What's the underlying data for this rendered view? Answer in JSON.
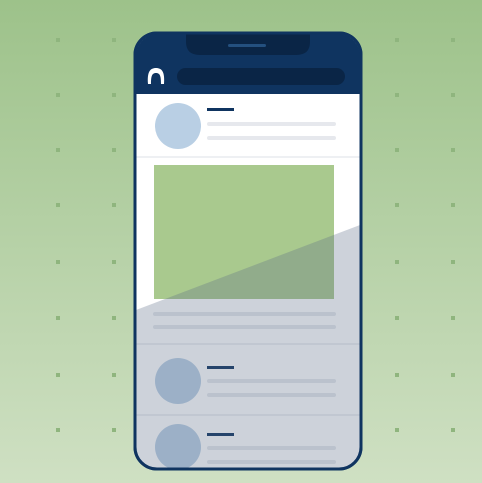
{
  "illustration": {
    "subject": "smartphone-social-feed",
    "colors": {
      "background_top": "#9dc28a",
      "background_bottom": "#cfe0c3",
      "dot": "#8fb57e",
      "phone_frame": "#0f3460",
      "phone_screen": "#ffffff",
      "avatar": "#b9cfe4",
      "avatar_shaded": "#9aaec2",
      "placeholder_line": "#e6e8ed",
      "media_block": "#a9c98e",
      "media_block_shaded": "#94ad80",
      "shade_overlay": "#c9cdd6"
    },
    "icons": [
      "user-icon"
    ],
    "feed": {
      "post_count": 3,
      "media_post_index": 1
    }
  }
}
